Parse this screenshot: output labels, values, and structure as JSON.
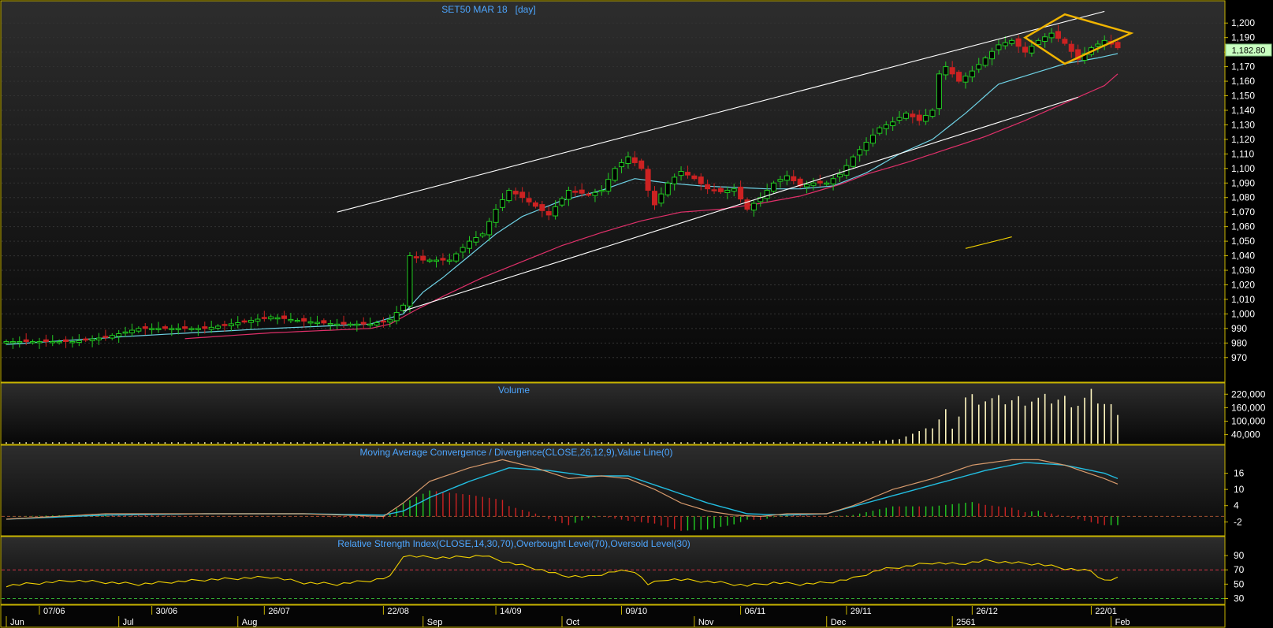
{
  "colors": {
    "background": "#000000",
    "panel_top": "#2b2b2b",
    "panel_bottom": "#050505",
    "border": "#c8b400",
    "grid": "#3a3a3a",
    "title": "#4da6ff",
    "axis_text": "#ffffff",
    "bull": "#22cc22",
    "bear": "#cc2222",
    "ma_short": "#6fd3e6",
    "ma_long": "#e0306a",
    "channel": "#ffffff",
    "diamond": "#f0b400",
    "rsi": "#f0d000",
    "macd_line": "#d79a6c",
    "macd_signal": "#22bde0",
    "volume": "#fff7c0",
    "price_label_bg": "#c8ffc0"
  },
  "price_panel": {
    "title": "SET50 MAR 18   [day]",
    "last_price_label": "1,182.80",
    "y_ticks": [
      "970",
      "980",
      "990",
      "1,000",
      "1,010",
      "1,020",
      "1,030",
      "1,040",
      "1,050",
      "1,060",
      "1,070",
      "1,080",
      "1,090",
      "1,100",
      "1,110",
      "1,120",
      "1,130",
      "1,140",
      "1,150",
      "1,160",
      "1,170",
      "1,180",
      "1,190",
      "1,200"
    ]
  },
  "volume_panel": {
    "title": "Volume",
    "y_ticks": [
      "40,000",
      "100,000",
      "160,000",
      "220,000"
    ]
  },
  "macd_panel": {
    "title": "Moving Average Convergence / Divergence(CLOSE,26,12,9),Value Line(0)",
    "y_ticks": [
      "-2",
      "4",
      "10",
      "16"
    ]
  },
  "rsi_panel": {
    "title": "Relative Strength Index(CLOSE,14,30,70),Overbought Level(70),Oversold Level(30)",
    "y_ticks": [
      "30",
      "50",
      "70",
      "90"
    ]
  },
  "x_axis": {
    "date_labels": [
      "07/06",
      "30/06",
      "26/07",
      "22/08",
      "14/09",
      "09/10",
      "06/11",
      "29/11",
      "26/12",
      "22/01"
    ],
    "month_labels": [
      "Jun",
      "Jul",
      "Aug",
      "Sep",
      "Oct",
      "Nov",
      "Dec",
      "2561",
      "Feb"
    ]
  },
  "chart_data": {
    "type": "candlestick",
    "title": "SET50 MAR 18   [day]",
    "ylim": [
      965,
      1205
    ],
    "n_bars": 169,
    "x_date_ticks": [
      {
        "label": "07/06",
        "index": 5
      },
      {
        "label": "30/06",
        "index": 22
      },
      {
        "label": "26/07",
        "index": 39
      },
      {
        "label": "22/08",
        "index": 57
      },
      {
        "label": "14/09",
        "index": 74
      },
      {
        "label": "09/10",
        "index": 93
      },
      {
        "label": "06/11",
        "index": 111
      },
      {
        "label": "29/11",
        "index": 127
      },
      {
        "label": "26/12",
        "index": 146
      },
      {
        "label": "22/01",
        "index": 164
      }
    ],
    "x_month_ticks": [
      {
        "label": "Jun",
        "index": 0
      },
      {
        "label": "Jul",
        "index": 17
      },
      {
        "label": "Aug",
        "index": 35
      },
      {
        "label": "Sep",
        "index": 63
      },
      {
        "label": "Oct",
        "index": 84
      },
      {
        "label": "Nov",
        "index": 104
      },
      {
        "label": "Dec",
        "index": 124
      },
      {
        "label": "2561",
        "index": 143
      },
      {
        "label": "Feb",
        "index": 167
      }
    ],
    "close_anchors": [
      [
        0,
        981
      ],
      [
        10,
        981
      ],
      [
        15,
        984
      ],
      [
        20,
        990
      ],
      [
        25,
        990
      ],
      [
        30,
        990
      ],
      [
        35,
        994
      ],
      [
        40,
        998
      ],
      [
        45,
        995
      ],
      [
        50,
        993
      ],
      [
        55,
        993
      ],
      [
        58,
        996
      ],
      [
        60,
        1006
      ],
      [
        61,
        1040
      ],
      [
        63,
        1037
      ],
      [
        67,
        1037
      ],
      [
        70,
        1050
      ],
      [
        72,
        1055
      ],
      [
        74,
        1072
      ],
      [
        76,
        1085
      ],
      [
        78,
        1080
      ],
      [
        82,
        1068
      ],
      [
        85,
        1085
      ],
      [
        88,
        1082
      ],
      [
        90,
        1085
      ],
      [
        92,
        1100
      ],
      [
        94,
        1108
      ],
      [
        96,
        1100
      ],
      [
        97,
        1085
      ],
      [
        98,
        1075
      ],
      [
        100,
        1090
      ],
      [
        102,
        1098
      ],
      [
        104,
        1093
      ],
      [
        106,
        1086
      ],
      [
        108,
        1084
      ],
      [
        110,
        1086
      ],
      [
        112,
        1072
      ],
      [
        114,
        1080
      ],
      [
        116,
        1090
      ],
      [
        118,
        1095
      ],
      [
        120,
        1088
      ],
      [
        122,
        1090
      ],
      [
        124,
        1090
      ],
      [
        126,
        1096
      ],
      [
        128,
        1108
      ],
      [
        130,
        1118
      ],
      [
        132,
        1128
      ],
      [
        134,
        1132
      ],
      [
        136,
        1138
      ],
      [
        138,
        1133
      ],
      [
        140,
        1140
      ],
      [
        141,
        1165
      ],
      [
        142,
        1170
      ],
      [
        144,
        1160
      ],
      [
        146,
        1167
      ],
      [
        148,
        1176
      ],
      [
        150,
        1185
      ],
      [
        152,
        1188
      ],
      [
        154,
        1180
      ],
      [
        156,
        1188
      ],
      [
        158,
        1193
      ],
      [
        160,
        1186
      ],
      [
        162,
        1175
      ],
      [
        164,
        1183
      ],
      [
        166,
        1188
      ],
      [
        168,
        1183
      ]
    ],
    "ma_short_anchors": [
      [
        0,
        979
      ],
      [
        20,
        985
      ],
      [
        40,
        990
      ],
      [
        55,
        993
      ],
      [
        60,
        1000
      ],
      [
        63,
        1015
      ],
      [
        66,
        1025
      ],
      [
        70,
        1040
      ],
      [
        74,
        1055
      ],
      [
        78,
        1067
      ],
      [
        84,
        1078
      ],
      [
        90,
        1085
      ],
      [
        95,
        1093
      ],
      [
        100,
        1090
      ],
      [
        105,
        1088
      ],
      [
        110,
        1087
      ],
      [
        115,
        1086
      ],
      [
        120,
        1086
      ],
      [
        125,
        1088
      ],
      [
        130,
        1097
      ],
      [
        135,
        1110
      ],
      [
        140,
        1120
      ],
      [
        145,
        1138
      ],
      [
        150,
        1158
      ],
      [
        155,
        1165
      ],
      [
        160,
        1172
      ],
      [
        165,
        1176
      ],
      [
        168,
        1179
      ]
    ],
    "ma_long_anchors": [
      [
        27,
        983
      ],
      [
        40,
        987
      ],
      [
        55,
        990
      ],
      [
        58,
        993
      ],
      [
        62,
        1003
      ],
      [
        66,
        1012
      ],
      [
        72,
        1025
      ],
      [
        78,
        1036
      ],
      [
        84,
        1047
      ],
      [
        90,
        1056
      ],
      [
        96,
        1064
      ],
      [
        102,
        1070
      ],
      [
        108,
        1072
      ],
      [
        114,
        1076
      ],
      [
        120,
        1081
      ],
      [
        126,
        1089
      ],
      [
        130,
        1096
      ],
      [
        136,
        1104
      ],
      [
        142,
        1113
      ],
      [
        148,
        1122
      ],
      [
        154,
        1133
      ],
      [
        160,
        1145
      ],
      [
        166,
        1157
      ],
      [
        168,
        1165
      ]
    ],
    "trend_lines": [
      {
        "from": [
          50,
          1070
        ],
        "to": [
          166,
          1208
        ]
      },
      {
        "from": [
          60,
          1002
        ],
        "to": [
          162,
          1149
        ]
      },
      {
        "from": [
          145,
          1045
        ],
        "to": [
          152,
          1053
        ]
      }
    ],
    "diamond": [
      [
        154,
        1190
      ],
      [
        160,
        1206
      ],
      [
        170,
        1193
      ],
      [
        160,
        1172
      ]
    ],
    "volume_anchors": [
      [
        0,
        6000
      ],
      [
        120,
        6000
      ],
      [
        130,
        8000
      ],
      [
        135,
        20000
      ],
      [
        140,
        80000
      ],
      [
        142,
        150000
      ],
      [
        143,
        60000
      ],
      [
        145,
        210000
      ],
      [
        150,
        195000
      ],
      [
        155,
        200000
      ],
      [
        160,
        200000
      ],
      [
        162,
        180000
      ],
      [
        164,
        220000
      ],
      [
        166,
        180000
      ],
      [
        168,
        150000
      ]
    ],
    "volume_ylim": [
      0,
      235000
    ],
    "macd_line_anchors": [
      [
        0,
        -1
      ],
      [
        15,
        1
      ],
      [
        30,
        1
      ],
      [
        45,
        1
      ],
      [
        57,
        0
      ],
      [
        60,
        5
      ],
      [
        64,
        13
      ],
      [
        70,
        18
      ],
      [
        75,
        21
      ],
      [
        80,
        18
      ],
      [
        85,
        14
      ],
      [
        90,
        15
      ],
      [
        94,
        14
      ],
      [
        98,
        10
      ],
      [
        102,
        5
      ],
      [
        106,
        2
      ],
      [
        110,
        0.5
      ],
      [
        114,
        0
      ],
      [
        118,
        1
      ],
      [
        124,
        1
      ],
      [
        128,
        4
      ],
      [
        134,
        10
      ],
      [
        140,
        14
      ],
      [
        146,
        19
      ],
      [
        152,
        21
      ],
      [
        156,
        21
      ],
      [
        160,
        19
      ],
      [
        166,
        14
      ],
      [
        168,
        12
      ]
    ],
    "macd_signal_anchors": [
      [
        0,
        -1
      ],
      [
        15,
        0.5
      ],
      [
        30,
        1
      ],
      [
        45,
        1
      ],
      [
        57,
        0.5
      ],
      [
        60,
        2
      ],
      [
        64,
        7
      ],
      [
        70,
        13
      ],
      [
        76,
        18
      ],
      [
        82,
        17
      ],
      [
        88,
        15
      ],
      [
        94,
        15
      ],
      [
        100,
        10
      ],
      [
        106,
        5
      ],
      [
        112,
        1
      ],
      [
        118,
        0.5
      ],
      [
        124,
        1
      ],
      [
        130,
        5
      ],
      [
        136,
        9
      ],
      [
        142,
        13
      ],
      [
        148,
        17
      ],
      [
        154,
        20
      ],
      [
        160,
        19
      ],
      [
        166,
        16
      ],
      [
        168,
        14
      ]
    ],
    "macd_ylim": [
      -6,
      22
    ],
    "rsi_anchors": [
      [
        0,
        48
      ],
      [
        10,
        55
      ],
      [
        20,
        50
      ],
      [
        30,
        56
      ],
      [
        40,
        60
      ],
      [
        45,
        52
      ],
      [
        50,
        50
      ],
      [
        55,
        55
      ],
      [
        58,
        60
      ],
      [
        60,
        90
      ],
      [
        63,
        88
      ],
      [
        67,
        87
      ],
      [
        72,
        90
      ],
      [
        76,
        80
      ],
      [
        80,
        72
      ],
      [
        84,
        62
      ],
      [
        88,
        60
      ],
      [
        92,
        68
      ],
      [
        95,
        68
      ],
      [
        97,
        50
      ],
      [
        100,
        57
      ],
      [
        104,
        55
      ],
      [
        108,
        52
      ],
      [
        112,
        48
      ],
      [
        116,
        52
      ],
      [
        120,
        50
      ],
      [
        124,
        52
      ],
      [
        128,
        58
      ],
      [
        132,
        70
      ],
      [
        136,
        75
      ],
      [
        140,
        80
      ],
      [
        144,
        78
      ],
      [
        148,
        83
      ],
      [
        152,
        80
      ],
      [
        156,
        78
      ],
      [
        160,
        72
      ],
      [
        164,
        68
      ],
      [
        166,
        55
      ],
      [
        168,
        58
      ]
    ],
    "rsi_ylim": [
      25,
      100
    ],
    "rsi_levels": [
      70,
      30
    ]
  }
}
